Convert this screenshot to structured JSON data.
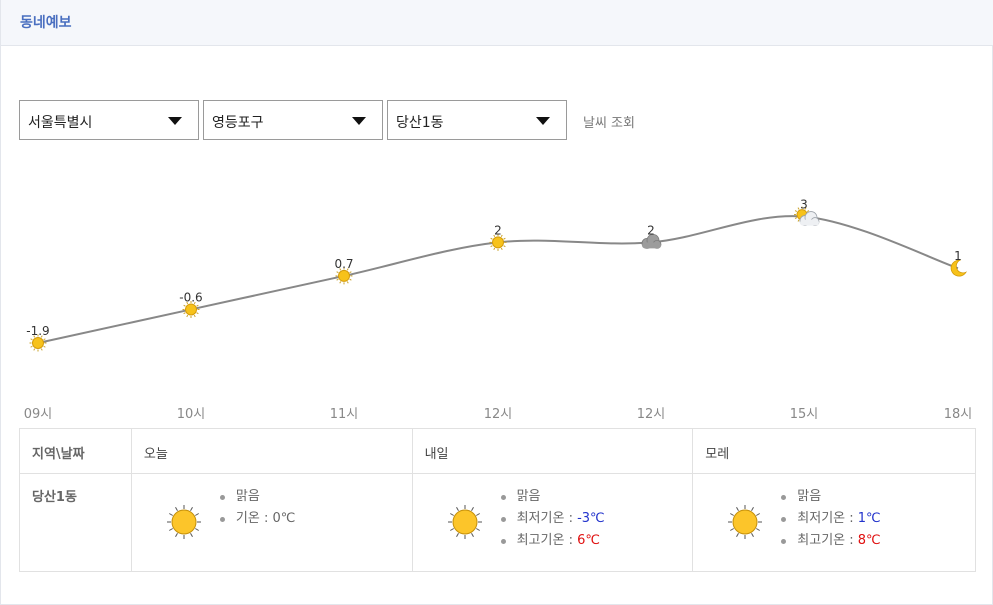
{
  "header": {
    "title": "동네예보"
  },
  "selects": [
    {
      "value": "서울특별시"
    },
    {
      "value": "영등포구"
    },
    {
      "value": "당산1동"
    }
  ],
  "query_button": "날씨 조회",
  "colors": {
    "accent": "#4a6fc0",
    "min_temp": "#2233cc",
    "max_temp": "#e01010",
    "line": "#888888"
  },
  "chart_data": {
    "type": "line",
    "x": [
      "09시",
      "10시",
      "11시",
      "12시",
      "12시",
      "15시",
      "18시"
    ],
    "values": [
      -1.9,
      -0.6,
      0.7,
      2,
      2,
      3,
      1
    ],
    "labels": [
      "-1.9",
      "-0.6",
      "0.7",
      "2",
      "2",
      "3",
      "1"
    ],
    "icons": [
      "sun-icon",
      "sun-icon",
      "sun-icon",
      "sun-icon",
      "cloud-icon",
      "sun-cloud-icon",
      "moon-icon"
    ]
  },
  "table": {
    "headers": [
      "지역\\날짜",
      "오늘",
      "내일",
      "모레"
    ],
    "area": "당산1동",
    "days": [
      {
        "icon": "sun-icon",
        "items": [
          {
            "label": "맑음"
          },
          {
            "label": "기온 : ",
            "value": "0℃"
          }
        ]
      },
      {
        "icon": "sun-icon",
        "items": [
          {
            "label": "맑음"
          },
          {
            "label": "최저기온 : ",
            "value": "-3℃",
            "tone": "blue"
          },
          {
            "label": "최고기온 : ",
            "value": "6℃",
            "tone": "red"
          }
        ]
      },
      {
        "icon": "sun-icon",
        "items": [
          {
            "label": "맑음"
          },
          {
            "label": "최저기온 : ",
            "value": "1℃",
            "tone": "blue"
          },
          {
            "label": "최고기온 : ",
            "value": "8℃",
            "tone": "red"
          }
        ]
      }
    ]
  }
}
